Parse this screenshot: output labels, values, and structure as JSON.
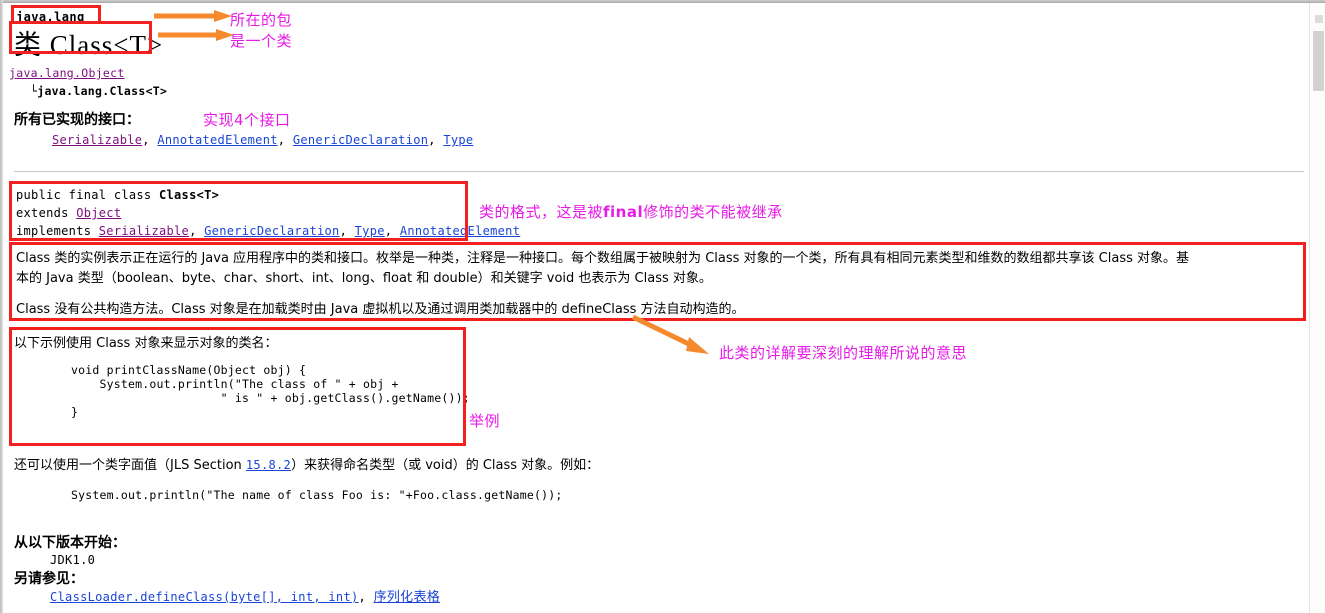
{
  "window": {
    "scrollbar": "vertical-scrollbar"
  },
  "header": {
    "package": "java.lang",
    "title": "类 Class<T>"
  },
  "hierarchy": {
    "parent": "java.lang.Object",
    "child_prefix": "└",
    "child": "java.lang.Class<T>"
  },
  "interfaces": {
    "heading": "所有已实现的接口：",
    "items": [
      {
        "label": "Serializable",
        "visited": true
      },
      {
        "label": "AnnotatedElement",
        "visited": false
      },
      {
        "label": "GenericDeclaration",
        "visited": false
      },
      {
        "label": "Type",
        "visited": false
      }
    ],
    "separators": [
      ", ",
      ", ",
      ", "
    ]
  },
  "signature": {
    "line1_prefix": "public final class ",
    "line1_name": "Class<T>",
    "line2_prefix": "extends ",
    "line2_link": "Object",
    "line3_prefix": "implements ",
    "line3_links": [
      {
        "label": "Serializable",
        "visited": true
      },
      {
        "label": "GenericDeclaration",
        "visited": false
      },
      {
        "label": "Type",
        "visited": false
      },
      {
        "label": "AnnotatedElement",
        "visited": false
      }
    ]
  },
  "description": {
    "para1_line1": "Class 类的实例表示正在运行的 Java 应用程序中的类和接口。枚举是一种类，注释是一种接口。每个数组属于被映射为 Class 对象的一个类，所有具有相同元素类型和维数的数组都共享该 Class 对象。基",
    "para1_line2": "本的 Java 类型（boolean、byte、char、short、int、long、float 和 double）和关键字 void 也表示为 Class 对象。",
    "para2_line1": "Class 没有公共构造方法。Class 对象是在加载类时由 Java 虚拟机以及通过调用类加载器中的 defineClass 方法自动构造的。"
  },
  "example": {
    "intro": "以下示例使用 Class 对象来显示对象的类名：",
    "code": "        void printClassName(Object obj) {\n            System.out.println(\"The class of \" + obj +\n                             \" is \" + obj.getClass().getName());\n        }"
  },
  "literal": {
    "line_prefix": "还可以使用一个类字面值（JLS Section ",
    "link": "15.8.2",
    "line_suffix": "）来获得命名类型（或 void）的 Class 对象。例如：",
    "code": "        System.out.println(\"The name of class Foo is: \"+Foo.class.getName());"
  },
  "since": {
    "heading": "从以下版本开始：",
    "value": "JDK1.0"
  },
  "seealso": {
    "heading": "另请参见：",
    "links": [
      {
        "label": "ClassLoader.defineClass(byte[], int, int)",
        "visited": false
      },
      {
        "label": "序列化表格",
        "visited": false
      }
    ],
    "separator": ", "
  },
  "annotations": [
    {
      "id": "anno-package",
      "text": "所在的包"
    },
    {
      "id": "anno-is-class",
      "text": "是一个类"
    },
    {
      "id": "anno-interfaces",
      "text": "实现4个接口"
    },
    {
      "id": "anno-format-a",
      "text": "类的格式，这是被"
    },
    {
      "id": "anno-format-b",
      "text": "final"
    },
    {
      "id": "anno-format-c",
      "text": "修饰的类不能被继承"
    },
    {
      "id": "anno-detail",
      "text": "此类的详解要深刻的理解所说的意思"
    },
    {
      "id": "anno-example",
      "text": "举例"
    }
  ],
  "colors": {
    "redbox": "#f42020",
    "arrow": "#f4892e",
    "annotation": "#e81ae8",
    "link": "#1a44d6",
    "link_visited": "#7b0f7b"
  }
}
